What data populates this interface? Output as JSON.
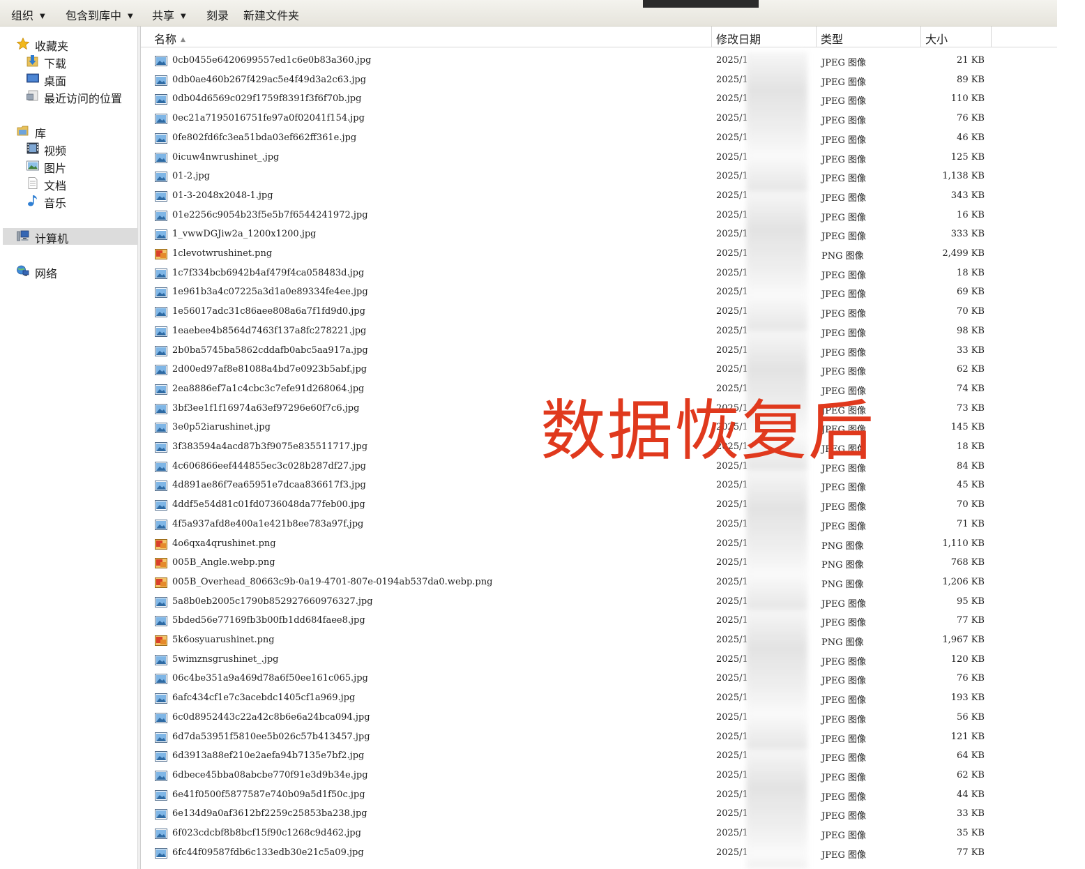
{
  "toolbar": {
    "organize": "组织",
    "include_in_library": "包含到库中",
    "share": "共享",
    "burn": "刻录",
    "new_folder": "新建文件夹"
  },
  "nav": {
    "favorites": "收藏夹",
    "downloads": "下载",
    "desktop": "桌面",
    "recent_places": "最近访问的位置",
    "libraries": "库",
    "videos": "视频",
    "pictures": "图片",
    "documents": "文档",
    "music": "音乐",
    "computer": "计算机",
    "network": "网络"
  },
  "columns": {
    "name": "名称",
    "modified": "修改日期",
    "type": "类型",
    "size": "大小"
  },
  "files": [
    {
      "name": "0cb0455e6420699557ed1c6e0b83a360.jpg",
      "date": "2025/1",
      "type": "JPEG 图像",
      "size": "21 KB",
      "kind": "jpg"
    },
    {
      "name": "0db0ae460b267f429ac5e4f49d3a2c63.jpg",
      "date": "2025/1",
      "type": "JPEG 图像",
      "size": "89 KB",
      "kind": "jpg"
    },
    {
      "name": "0db04d6569c029f1759f8391f3f6f70b.jpg",
      "date": "2025/1",
      "type": "JPEG 图像",
      "size": "110 KB",
      "kind": "jpg"
    },
    {
      "name": "0ec21a7195016751fe97a0f02041f154.jpg",
      "date": "2025/1",
      "type": "JPEG 图像",
      "size": "76 KB",
      "kind": "jpg"
    },
    {
      "name": "0fe802fd6fc3ea51bda03ef662ff361e.jpg",
      "date": "2025/1",
      "type": "JPEG 图像",
      "size": "46 KB",
      "kind": "jpg"
    },
    {
      "name": "0icuw4nwrushinet_.jpg",
      "date": "2025/1",
      "type": "JPEG 图像",
      "size": "125 KB",
      "kind": "jpg"
    },
    {
      "name": "01-2.jpg",
      "date": "2025/1",
      "type": "JPEG 图像",
      "size": "1,138 KB",
      "kind": "jpg"
    },
    {
      "name": "01-3-2048x2048-1.jpg",
      "date": "2025/1",
      "type": "JPEG 图像",
      "size": "343 KB",
      "kind": "jpg"
    },
    {
      "name": "01e2256c9054b23f5e5b7f6544241972.jpg",
      "date": "2025/1",
      "type": "JPEG 图像",
      "size": "16 KB",
      "kind": "jpg"
    },
    {
      "name": "1_vwwDGJiw2a_1200x1200.jpg",
      "date": "2025/1",
      "type": "JPEG 图像",
      "size": "333 KB",
      "kind": "jpg"
    },
    {
      "name": "1clevotwrushinet.png",
      "date": "2025/1",
      "type": "PNG 图像",
      "size": "2,499 KB",
      "kind": "png"
    },
    {
      "name": "1c7f334bcb6942b4af479f4ca058483d.jpg",
      "date": "2025/1",
      "type": "JPEG 图像",
      "size": "18 KB",
      "kind": "jpg"
    },
    {
      "name": "1e961b3a4c07225a3d1a0e89334fe4ee.jpg",
      "date": "2025/1",
      "type": "JPEG 图像",
      "size": "69 KB",
      "kind": "jpg"
    },
    {
      "name": "1e56017adc31c86aee808a6a7f1fd9d0.jpg",
      "date": "2025/1",
      "type": "JPEG 图像",
      "size": "70 KB",
      "kind": "jpg"
    },
    {
      "name": "1eaebee4b8564d7463f137a8fc278221.jpg",
      "date": "2025/1",
      "type": "JPEG 图像",
      "size": "98 KB",
      "kind": "jpg"
    },
    {
      "name": "2b0ba5745ba5862cddafb0abc5aa917a.jpg",
      "date": "2025/1",
      "type": "JPEG 图像",
      "size": "33 KB",
      "kind": "jpg"
    },
    {
      "name": "2d00ed97af8e81088a4bd7e0923b5abf.jpg",
      "date": "2025/1",
      "type": "JPEG 图像",
      "size": "62 KB",
      "kind": "jpg"
    },
    {
      "name": "2ea8886ef7a1c4cbc3c7efe91d268064.jpg",
      "date": "2025/1",
      "type": "JPEG 图像",
      "size": "74 KB",
      "kind": "jpg"
    },
    {
      "name": "3bf3ee1f1f16974a63ef97296e60f7c6.jpg",
      "date": "2025/1",
      "type": "JPEG 图像",
      "size": "73 KB",
      "kind": "jpg"
    },
    {
      "name": "3e0p52iarushinet.jpg",
      "date": "2025/1",
      "type": "JPEG 图像",
      "size": "145 KB",
      "kind": "jpg"
    },
    {
      "name": "3f383594a4acd87b3f9075e835511717.jpg",
      "date": "2025/1",
      "type": "JPEG 图像",
      "size": "18 KB",
      "kind": "jpg"
    },
    {
      "name": "4c606866eef444855ec3c028b287df27.jpg",
      "date": "2025/1",
      "type": "JPEG 图像",
      "size": "84 KB",
      "kind": "jpg"
    },
    {
      "name": "4d891ae86f7ea65951e7dcaa836617f3.jpg",
      "date": "2025/1",
      "type": "JPEG 图像",
      "size": "45 KB",
      "kind": "jpg"
    },
    {
      "name": "4ddf5e54d81c01fd0736048da77feb00.jpg",
      "date": "2025/1",
      "type": "JPEG 图像",
      "size": "70 KB",
      "kind": "jpg"
    },
    {
      "name": "4f5a937afd8e400a1e421b8ee783a97f.jpg",
      "date": "2025/1",
      "type": "JPEG 图像",
      "size": "71 KB",
      "kind": "jpg"
    },
    {
      "name": "4o6qxa4qrushinet.png",
      "date": "2025/1",
      "type": "PNG 图像",
      "size": "1,110 KB",
      "kind": "png"
    },
    {
      "name": "005B_Angle.webp.png",
      "date": "2025/1",
      "type": "PNG 图像",
      "size": "768 KB",
      "kind": "png"
    },
    {
      "name": "005B_Overhead_80663c9b-0a19-4701-807e-0194ab537da0.webp.png",
      "date": "2025/1",
      "type": "PNG 图像",
      "size": "1,206 KB",
      "kind": "png"
    },
    {
      "name": "5a8b0eb2005c1790b852927660976327.jpg",
      "date": "2025/1",
      "type": "JPEG 图像",
      "size": "95 KB",
      "kind": "jpg"
    },
    {
      "name": "5bded56e77169fb3b00fb1dd684faee8.jpg",
      "date": "2025/1",
      "type": "JPEG 图像",
      "size": "77 KB",
      "kind": "jpg"
    },
    {
      "name": "5k6osyuarushinet.png",
      "date": "2025/1",
      "type": "PNG 图像",
      "size": "1,967 KB",
      "kind": "png"
    },
    {
      "name": "5wimznsgrushinet_.jpg",
      "date": "2025/1",
      "type": "JPEG 图像",
      "size": "120 KB",
      "kind": "jpg"
    },
    {
      "name": "06c4be351a9a469d78a6f50ee161c065.jpg",
      "date": "2025/1",
      "type": "JPEG 图像",
      "size": "76 KB",
      "kind": "jpg"
    },
    {
      "name": "6afc434cf1e7c3acebdc1405cf1a969.jpg",
      "date": "2025/1",
      "type": "JPEG 图像",
      "size": "193 KB",
      "kind": "jpg"
    },
    {
      "name": "6c0d8952443c22a42c8b6e6a24bca094.jpg",
      "date": "2025/1",
      "type": "JPEG 图像",
      "size": "56 KB",
      "kind": "jpg"
    },
    {
      "name": "6d7da53951f5810ee5b026c57b413457.jpg",
      "date": "2025/1",
      "type": "JPEG 图像",
      "size": "121 KB",
      "kind": "jpg"
    },
    {
      "name": "6d3913a88ef210e2aefa94b7135e7bf2.jpg",
      "date": "2025/1",
      "type": "JPEG 图像",
      "size": "64 KB",
      "kind": "jpg"
    },
    {
      "name": "6dbece45bba08abcbe770f91e3d9b34e.jpg",
      "date": "2025/1",
      "type": "JPEG 图像",
      "size": "62 KB",
      "kind": "jpg"
    },
    {
      "name": "6e41f0500f5877587e740b09a5d1f50c.jpg",
      "date": "2025/1",
      "type": "JPEG 图像",
      "size": "44 KB",
      "kind": "jpg"
    },
    {
      "name": "6e134d9a0af3612bf2259c25853ba238.jpg",
      "date": "2025/1",
      "type": "JPEG 图像",
      "size": "33 KB",
      "kind": "jpg"
    },
    {
      "name": "6f023cdcbf8b8bcf15f90c1268c9d462.jpg",
      "date": "2025/1",
      "type": "JPEG 图像",
      "size": "35 KB",
      "kind": "jpg"
    },
    {
      "name": "6fc44f09587fdb6c133edb30e21c5a09.jpg",
      "date": "2025/1",
      "type": "JPEG 图像",
      "size": "77 KB",
      "kind": "jpg"
    }
  ],
  "overlay_text": "数据恢复后",
  "colors": {
    "watermark": "#e0391d",
    "selected_nav": "#dcdcdc",
    "jpg_icon": "#3a88c8",
    "png_icon": "#c0392b"
  }
}
